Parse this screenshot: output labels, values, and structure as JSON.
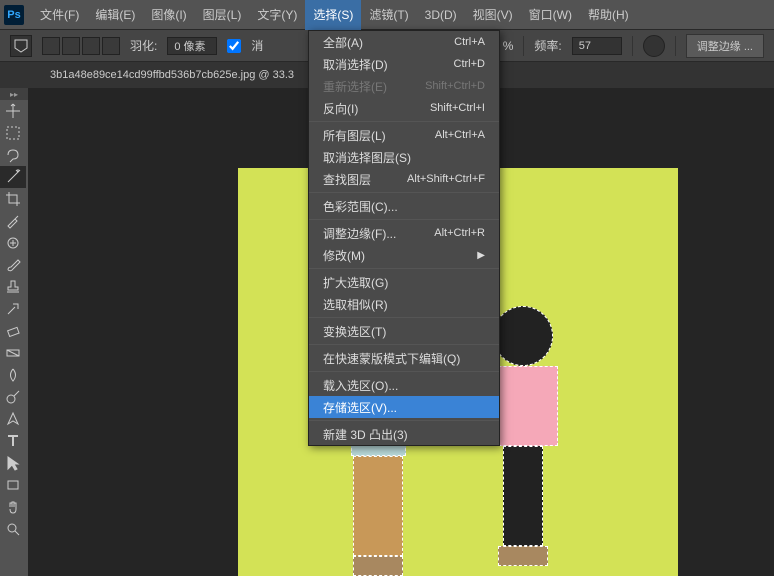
{
  "app": {
    "name": "Ps"
  },
  "menubar": {
    "items": [
      "文件(F)",
      "编辑(E)",
      "图像(I)",
      "图层(L)",
      "文字(Y)",
      "选择(S)",
      "滤镜(T)",
      "3D(D)",
      "视图(V)",
      "窗口(W)",
      "帮助(H)"
    ],
    "active_index": 5
  },
  "options": {
    "feather_label": "羽化:",
    "feather_value": "0 像素",
    "antialias": "消",
    "freq_label": "频率:",
    "freq_value": "57",
    "percent": "%",
    "refine": "调整边缘 ..."
  },
  "document": {
    "tab": "3b1a48e89ce14cd99ffbd536b7cb625e.jpg @ 33.3"
  },
  "dropdown": {
    "groups": [
      [
        {
          "label": "全部(A)",
          "shortcut": "Ctrl+A",
          "disabled": false
        },
        {
          "label": "取消选择(D)",
          "shortcut": "Ctrl+D",
          "disabled": false
        },
        {
          "label": "重新选择(E)",
          "shortcut": "Shift+Ctrl+D",
          "disabled": true
        },
        {
          "label": "反向(I)",
          "shortcut": "Shift+Ctrl+I",
          "disabled": false
        }
      ],
      [
        {
          "label": "所有图层(L)",
          "shortcut": "Alt+Ctrl+A",
          "disabled": false
        },
        {
          "label": "取消选择图层(S)",
          "shortcut": "",
          "disabled": false
        },
        {
          "label": "查找图层",
          "shortcut": "Alt+Shift+Ctrl+F",
          "disabled": false
        }
      ],
      [
        {
          "label": "色彩范围(C)...",
          "shortcut": "",
          "disabled": false
        }
      ],
      [
        {
          "label": "调整边缘(F)...",
          "shortcut": "Alt+Ctrl+R",
          "disabled": false
        },
        {
          "label": "修改(M)",
          "shortcut": "",
          "disabled": false,
          "submenu": true
        }
      ],
      [
        {
          "label": "扩大选取(G)",
          "shortcut": "",
          "disabled": false
        },
        {
          "label": "选取相似(R)",
          "shortcut": "",
          "disabled": false
        }
      ],
      [
        {
          "label": "变换选区(T)",
          "shortcut": "",
          "disabled": false
        }
      ],
      [
        {
          "label": "在快速蒙版模式下编辑(Q)",
          "shortcut": "",
          "disabled": false
        }
      ],
      [
        {
          "label": "载入选区(O)...",
          "shortcut": "",
          "disabled": false
        },
        {
          "label": "存储选区(V)...",
          "shortcut": "",
          "disabled": false,
          "highlighted": true
        }
      ],
      [
        {
          "label": "新建 3D 凸出(3)",
          "shortcut": "",
          "disabled": false
        }
      ]
    ]
  },
  "tools": [
    "move",
    "marquee",
    "lasso",
    "wand",
    "crop",
    "eyedropper",
    "spot-heal",
    "brush",
    "stamp",
    "history-brush",
    "eraser",
    "gradient",
    "blur",
    "dodge",
    "pen",
    "type",
    "path-select",
    "rectangle",
    "hand",
    "zoom"
  ]
}
